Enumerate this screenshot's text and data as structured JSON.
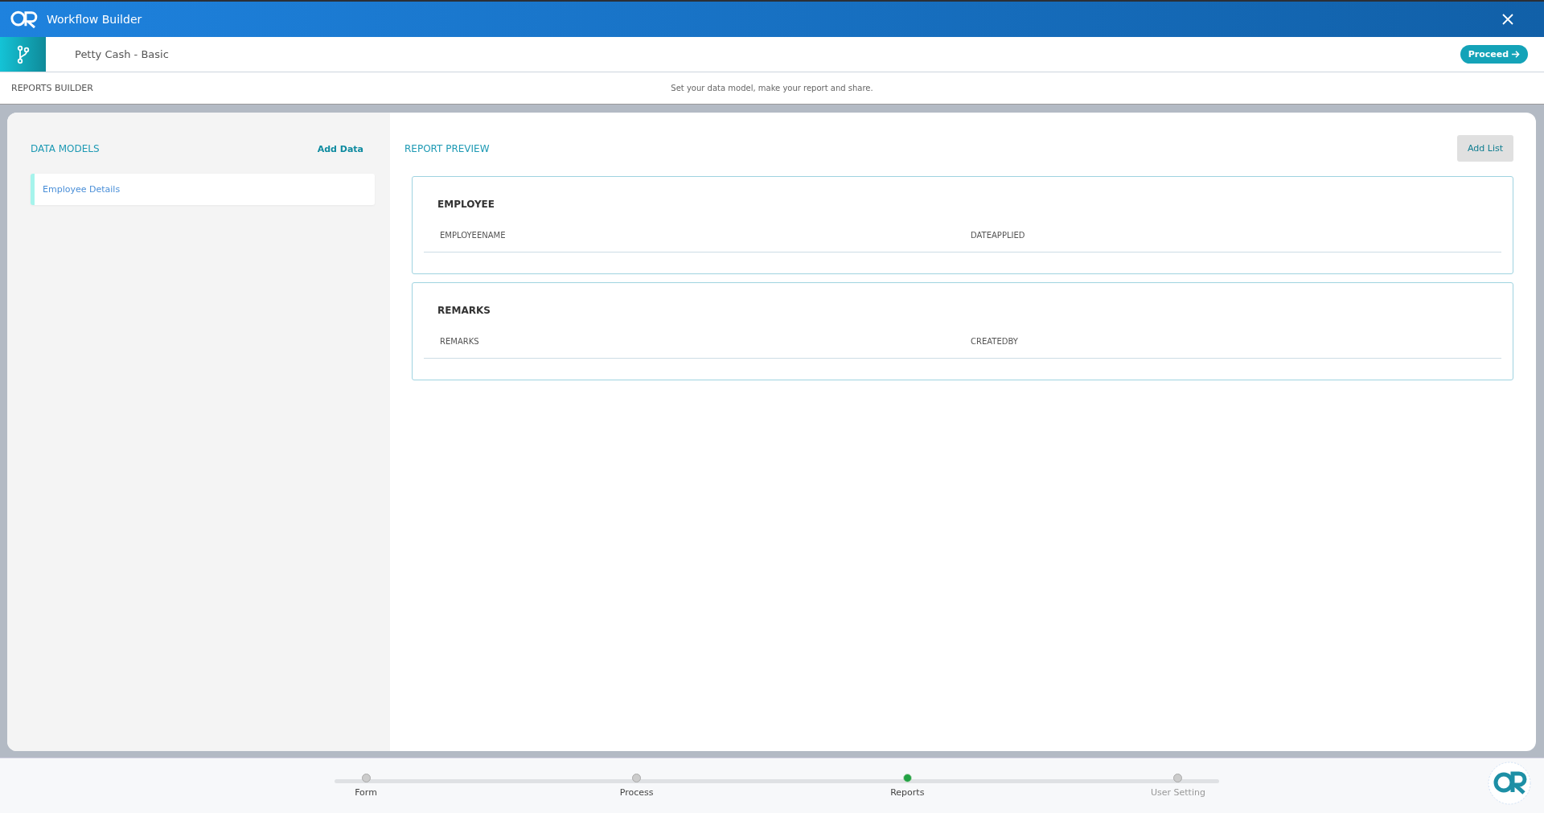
{
  "window": {
    "title": "Workflow Builder"
  },
  "header": {
    "workflow_name": "Petty Cash - Basic",
    "proceed_button": "Proceed"
  },
  "subheader": {
    "title": "REPORTS BUILDER",
    "hint": "Set your data model, make your report and share."
  },
  "data_models": {
    "title": "DATA MODELS",
    "add_button": "Add Data",
    "items": [
      {
        "label": "Employee Details",
        "selected": true
      }
    ]
  },
  "report_preview": {
    "title": "REPORT PREVIEW",
    "add_button": "Add List",
    "sections": [
      {
        "title": "EMPLOYEE",
        "fields": [
          "EMPLOYEENAME",
          "DATEAPPLIED"
        ]
      },
      {
        "title": "REMARKS",
        "fields": [
          "REMARKS",
          "CREATEDBY"
        ]
      }
    ]
  },
  "steps": [
    {
      "label": "Form",
      "selected": false,
      "disabled": false
    },
    {
      "label": "Process",
      "selected": false,
      "disabled": false
    },
    {
      "label": "Reports",
      "selected": true,
      "disabled": false
    },
    {
      "label": "User Setting",
      "selected": false,
      "disabled": true
    }
  ]
}
